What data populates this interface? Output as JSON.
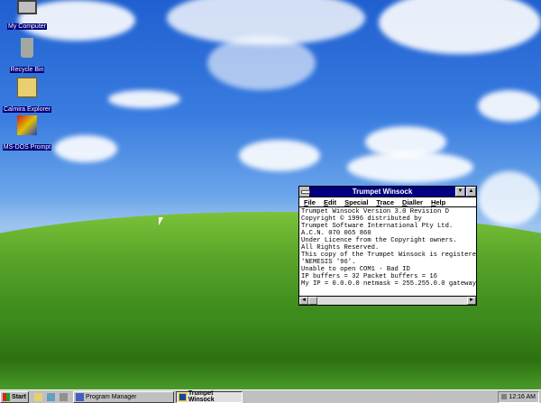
{
  "desktop": {
    "icons": [
      {
        "label": "My Computer"
      },
      {
        "label": "Recycle Bin"
      },
      {
        "label": "Calmira Explorer"
      },
      {
        "label": "MS-DOS Prompt"
      }
    ]
  },
  "window": {
    "title": "Trumpet Winsock",
    "menu": [
      "File",
      "Edit",
      "Special",
      "Trace",
      "Dialler",
      "Help"
    ],
    "lines": [
      "Trumpet Winsock Version 3.0 Revision D",
      "Copyright © 1996 distributed by",
      "Trumpet Software International Pty Ltd.",
      "A.C.N. 070 065 860",
      "Under Licence from the Copyright owners.",
      "All Rights Reserved.",
      "This copy of the Trumpet Winsock is registered to",
      "'NEMESIS '96'.",
      "Unable to open COM1 - Bad ID",
      "IP buffers = 32 Packet buffers = 16",
      "My IP = 0.0.0.0 netmask = 255.255.0.0 gateway"
    ]
  },
  "taskbar": {
    "start": "Start",
    "tasks": [
      "Program Manager",
      "Trumpet Winsock"
    ],
    "active_task": "Trumpet Winsock",
    "clock": "12:16 AM"
  }
}
